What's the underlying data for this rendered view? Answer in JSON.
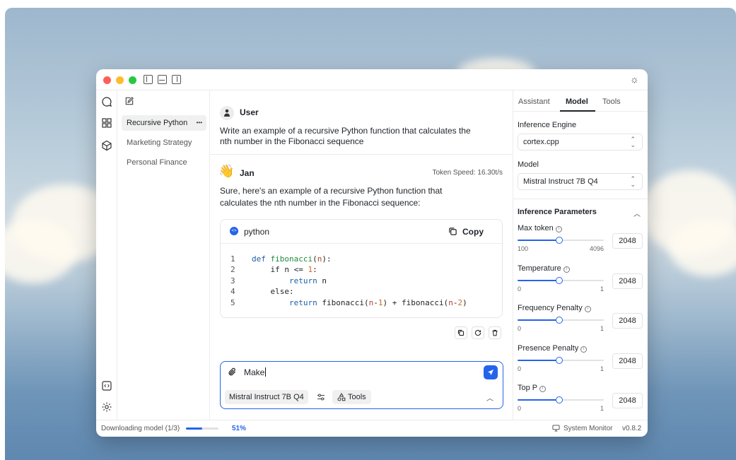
{
  "titlebar": {
    "icons": [
      "panel-left-icon",
      "panel-bottom-icon",
      "panel-right-icon",
      "sun-icon"
    ]
  },
  "rail": {
    "icons": [
      "chat-icon",
      "grid-icon",
      "cube-icon",
      "terminal-icon",
      "gear-icon"
    ]
  },
  "threads": {
    "items": [
      {
        "label": "Recursive Python",
        "active": true
      },
      {
        "label": "Marketing Strategy",
        "active": false
      },
      {
        "label": "Personal Finance",
        "active": false
      }
    ],
    "more_glyph": "•••"
  },
  "chat": {
    "user": {
      "name": "User",
      "message_line1": "Write an example of a recursive Python function that calculates the",
      "message_line2": "nth number in the Fibonacci sequence"
    },
    "assistant": {
      "name": "Jan",
      "token_speed": "Token Speed: 16.30t/s",
      "message_line1": "Sure, here's an example of a recursive Python function that",
      "message_line2": "calculates the nth number in the Fibonacci sequence:",
      "code": {
        "language": "python",
        "copy_label": "Copy",
        "line_numbers": [
          "1",
          "2",
          "3",
          "4",
          "5"
        ]
      }
    },
    "composer": {
      "value": "Make",
      "model_label": "Mistral Instruct 7B Q4",
      "tools_label": "Tools"
    }
  },
  "panel": {
    "tabs": [
      {
        "label": "Assistant",
        "active": false
      },
      {
        "label": "Model",
        "active": true
      },
      {
        "label": "Tools",
        "active": false
      }
    ],
    "engine_label": "Inference Engine",
    "engine_value": "cortex.cpp",
    "model_label": "Model",
    "model_value": "Mistral Instruct 7B Q4",
    "params_title": "Inference Parameters",
    "params": [
      {
        "label": "Max token",
        "min": "100",
        "max": "4096",
        "level": 0.48,
        "value": "2048"
      },
      {
        "label": "Temperature",
        "min": "0",
        "max": "1",
        "level": 0.48,
        "value": "2048"
      },
      {
        "label": "Frequency Penalty",
        "min": "0",
        "max": "1",
        "level": 0.48,
        "value": "2048"
      },
      {
        "label": "Presence Penalty",
        "min": "0",
        "max": "1",
        "level": 0.48,
        "value": "2048"
      },
      {
        "label": "Top P",
        "min": "0",
        "max": "1",
        "level": 0.48,
        "value": "2048"
      }
    ]
  },
  "status": {
    "download_label": "Downloading model (1/3)",
    "progress_percent": "51%",
    "progress_level": 0.51,
    "monitor_label": "System Monitor",
    "version": "v0.8.2"
  },
  "colors": {
    "accent": "#2563eb",
    "close": "#ff5f57",
    "minimize": "#febc2e",
    "maximize": "#28c840"
  }
}
